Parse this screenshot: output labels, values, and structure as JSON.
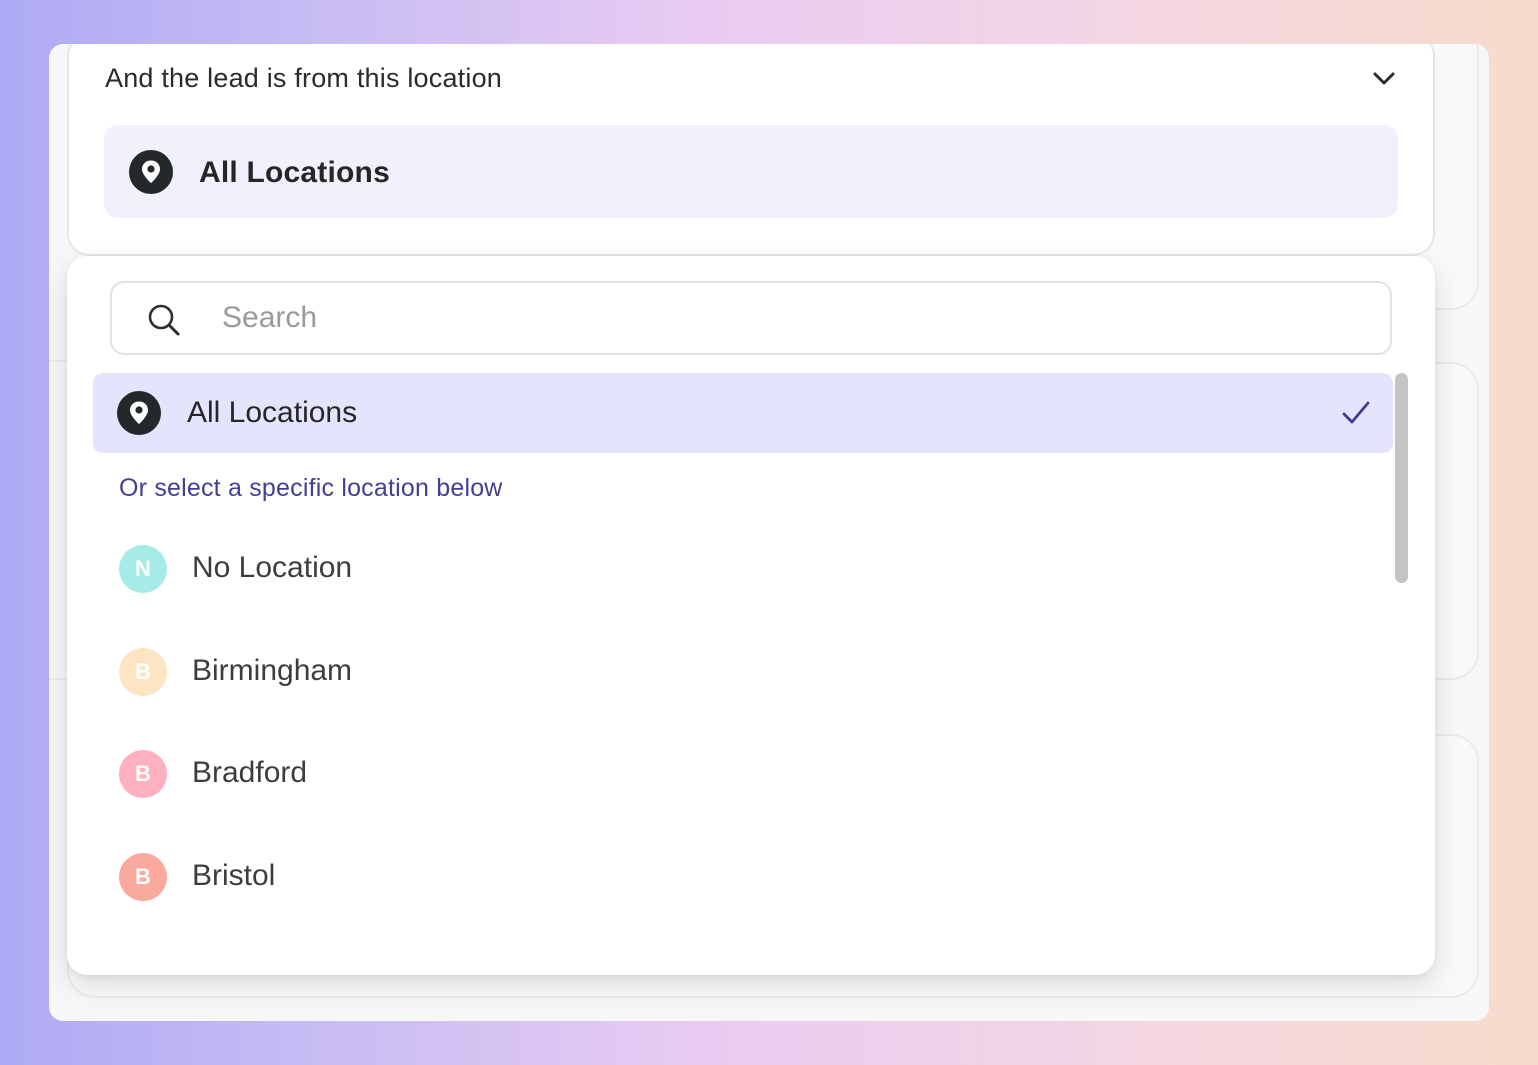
{
  "trigger": {
    "title": "And the lead is from this location",
    "selected_value": "All Locations",
    "selected_icon": "map-pin-icon"
  },
  "dropdown": {
    "search": {
      "placeholder": "Search",
      "value": ""
    },
    "all_option": {
      "label": "All Locations",
      "selected": true,
      "icon": "map-pin-icon",
      "check_icon": "checkmark-icon"
    },
    "section_hint": "Or select a specific location below",
    "locations": [
      {
        "initial": "N",
        "label": "No Location",
        "color": "#a6ebe8"
      },
      {
        "initial": "B",
        "label": "Birmingham",
        "color": "#fde5c4"
      },
      {
        "initial": "B",
        "label": "Bradford",
        "color": "#ffb0bf"
      },
      {
        "initial": "B",
        "label": "Bristol",
        "color": "#f9a99d"
      }
    ]
  },
  "colors": {
    "selected_bg": "#e4e5fc",
    "hint_text": "#433f93",
    "check": "#3f3c8e"
  }
}
